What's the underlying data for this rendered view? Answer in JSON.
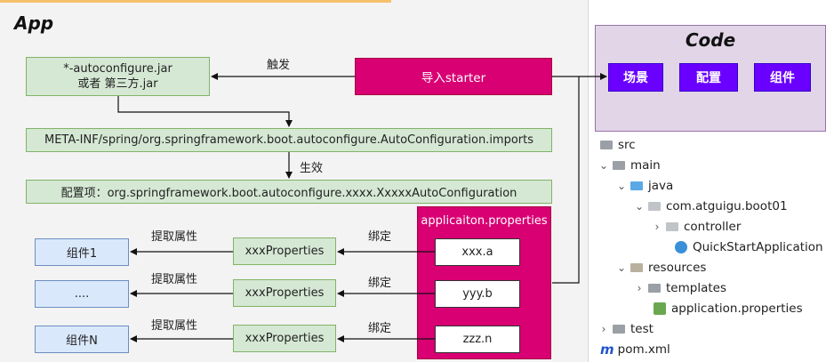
{
  "app": {
    "title": "App",
    "boxes": {
      "autoconfigure_line1": "*-autoconfigure.jar",
      "autoconfigure_line2": "或者 第三方.jar",
      "import_starter": "导入starter",
      "imports_file": "META-INF/spring/org.springframework.boot.autoconfigure.AutoConfiguration.imports",
      "config_item": "配置项：org.springframework.boot.autoconfigure.xxxx.XxxxxAutoConfiguration",
      "properties_header": "applicaiton.properties"
    },
    "labels": {
      "trigger": "触发",
      "effect": "生效"
    },
    "rows": [
      {
        "component": "组件1",
        "extract": "提取属性",
        "properties_class": "xxxProperties",
        "bind": "绑定",
        "property": "xxx.a"
      },
      {
        "component": "....",
        "extract": "提取属性",
        "properties_class": "xxxProperties",
        "bind": "绑定",
        "property": "yyy.b"
      },
      {
        "component": "组件N",
        "extract": "提取属性",
        "properties_class": "xxxProperties",
        "bind": "绑定",
        "property": "zzz.n"
      }
    ]
  },
  "code": {
    "title": "Code",
    "buttons": [
      "场景",
      "配置",
      "组件"
    ]
  },
  "tree": {
    "items": [
      {
        "label": "src"
      },
      {
        "label": "main"
      },
      {
        "label": "java"
      },
      {
        "label": "com.atguigu.boot01"
      },
      {
        "label": "controller"
      },
      {
        "label": "QuickStartApplication"
      },
      {
        "label": "resources"
      },
      {
        "label": "templates"
      },
      {
        "label": "application.properties"
      },
      {
        "label": "test"
      },
      {
        "label": "pom.xml"
      }
    ]
  },
  "colors": {
    "green_fill": "#d5e8d4",
    "blue_fill": "#dae8fc",
    "pink_fill": "#d80073",
    "purple_fill": "#e1d5e7",
    "violet_button": "#6a00ff"
  }
}
